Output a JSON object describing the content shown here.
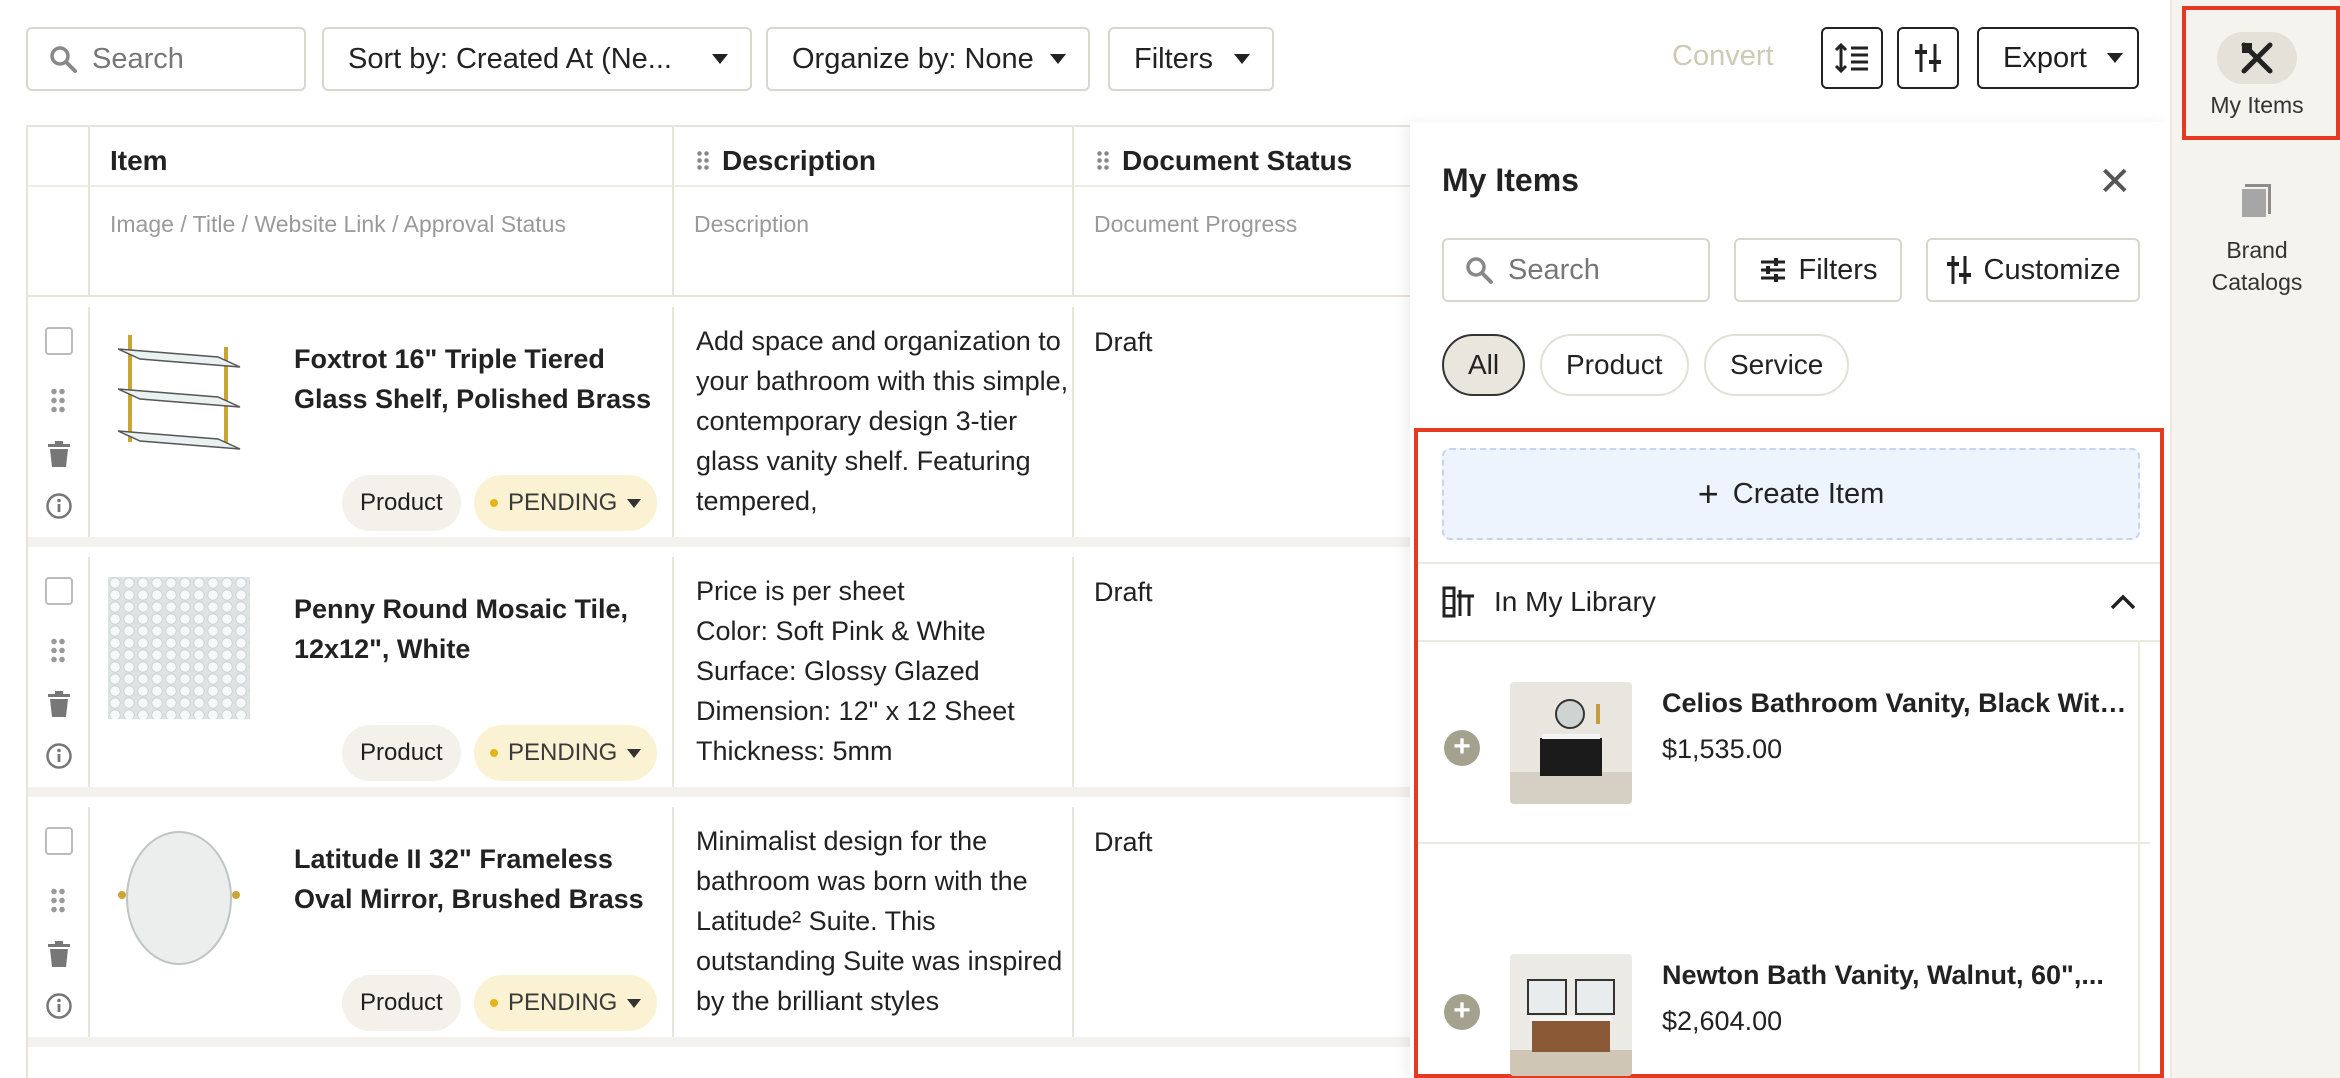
{
  "toolbar": {
    "search_placeholder": "Search",
    "sort_label": "Sort by: Created At (Ne...",
    "organize_label": "Organize by: None",
    "filters_label": "Filters",
    "convert_label": "Convert",
    "export_label": "Export"
  },
  "table": {
    "columns": [
      {
        "title": "Item",
        "subtitle": "Image / Title / Website Link / Approval Status"
      },
      {
        "title": "Description",
        "subtitle": "Description"
      },
      {
        "title": "Document Status",
        "subtitle": "Document Progress"
      }
    ],
    "rows": [
      {
        "title": "Foxtrot 16\" Triple Tiered Glass Shelf, Polished Brass",
        "type": "Product",
        "status": "PENDING",
        "description": "Add space and organization to your bathroom with this simple, contemporary design 3-tier glass vanity shelf. Featuring tempered,",
        "document_status": "Draft"
      },
      {
        "title": "Penny Round Mosaic Tile, 12x12\", White",
        "type": "Product",
        "status": "PENDING",
        "description": "Price is per sheet\nColor: Soft Pink & White\nSurface: Glossy Glazed\nDimension: 12\" x 12 Sheet\nThickness: 5mm",
        "document_status": "Draft"
      },
      {
        "title": "Latitude II 32\" Frameless Oval Mirror, Brushed Brass",
        "type": "Product",
        "status": "PENDING",
        "description": "Minimalist design for the bathroom was born with the Latitude² Suite. This outstanding Suite was inspired by the brilliant styles",
        "document_status": "Draft"
      }
    ]
  },
  "panel": {
    "title": "My Items",
    "search_placeholder": "Search",
    "filters_label": "Filters",
    "customize_label": "Customize",
    "chips": [
      "All",
      "Product",
      "Service"
    ],
    "create_label": "Create Item",
    "library_label": "In My Library",
    "library_items": [
      {
        "name": "Celios Bathroom Vanity, Black With...",
        "price": "$1,535.00"
      },
      {
        "name": "Newton Bath Vanity, Walnut, 60\",...",
        "price": "$2,604.00"
      }
    ]
  },
  "rail": {
    "my_items_label": "My Items",
    "brand_catalogs_label": "Brand Catalogs"
  },
  "colors": {
    "highlight": "#e53a1f",
    "pending_bg": "#fbf1d3",
    "pending_dot": "#e7b416",
    "create_bg": "#eef4fd"
  }
}
